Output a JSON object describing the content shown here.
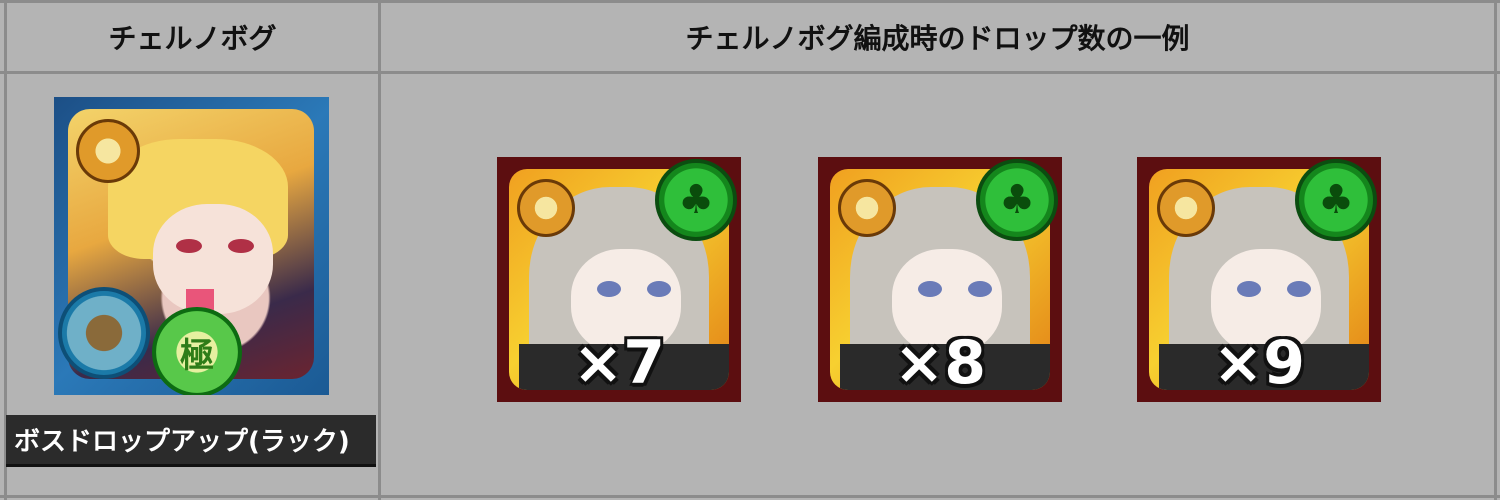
{
  "table": {
    "header_left": "チェルノボグ",
    "header_right": "チェルノボグ編成時のドロップ数の一例"
  },
  "character": {
    "skill_label": "ボスドロップアップ(ラック)",
    "grade_badge": "極"
  },
  "drops": [
    {
      "multiplier": "×7"
    },
    {
      "multiplier": "×8"
    },
    {
      "multiplier": "×9"
    }
  ],
  "icons": {
    "luck": "clover-icon",
    "medal": "medal-icon"
  }
}
